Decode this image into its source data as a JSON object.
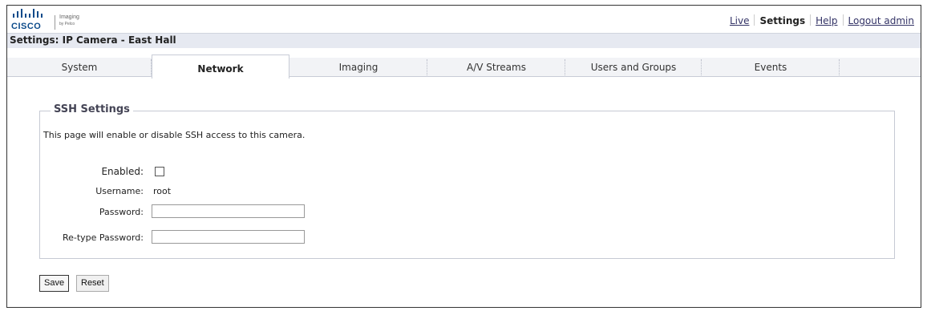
{
  "brand": {
    "logo_text": "CISCO",
    "imaging_text": "Imaging",
    "pelco_text": "by Pelco"
  },
  "topnav": {
    "live": "Live",
    "settings": "Settings",
    "help": "Help",
    "logout": "Logout admin"
  },
  "page_title": "Settings: IP Camera - East Hall",
  "tabs": [
    {
      "label": "System"
    },
    {
      "label": "Network"
    },
    {
      "label": "Imaging"
    },
    {
      "label": "A/V Streams"
    },
    {
      "label": "Users and Groups"
    },
    {
      "label": "Events"
    }
  ],
  "ssh": {
    "legend": "SSH Settings",
    "description": "This page will enable or disable SSH access to this camera.",
    "enabled_label": "Enabled:",
    "enabled_checked": false,
    "username_label": "Username:",
    "username_value": "root",
    "password_label": "Password:",
    "password_value": "",
    "retype_label": "Re-type Password:",
    "retype_value": ""
  },
  "buttons": {
    "save": "Save",
    "reset": "Reset"
  },
  "colors": {
    "brand_blue": "#0b4a8a",
    "title_bar_bg": "#e6e9f1",
    "legend_text": "#445"
  }
}
